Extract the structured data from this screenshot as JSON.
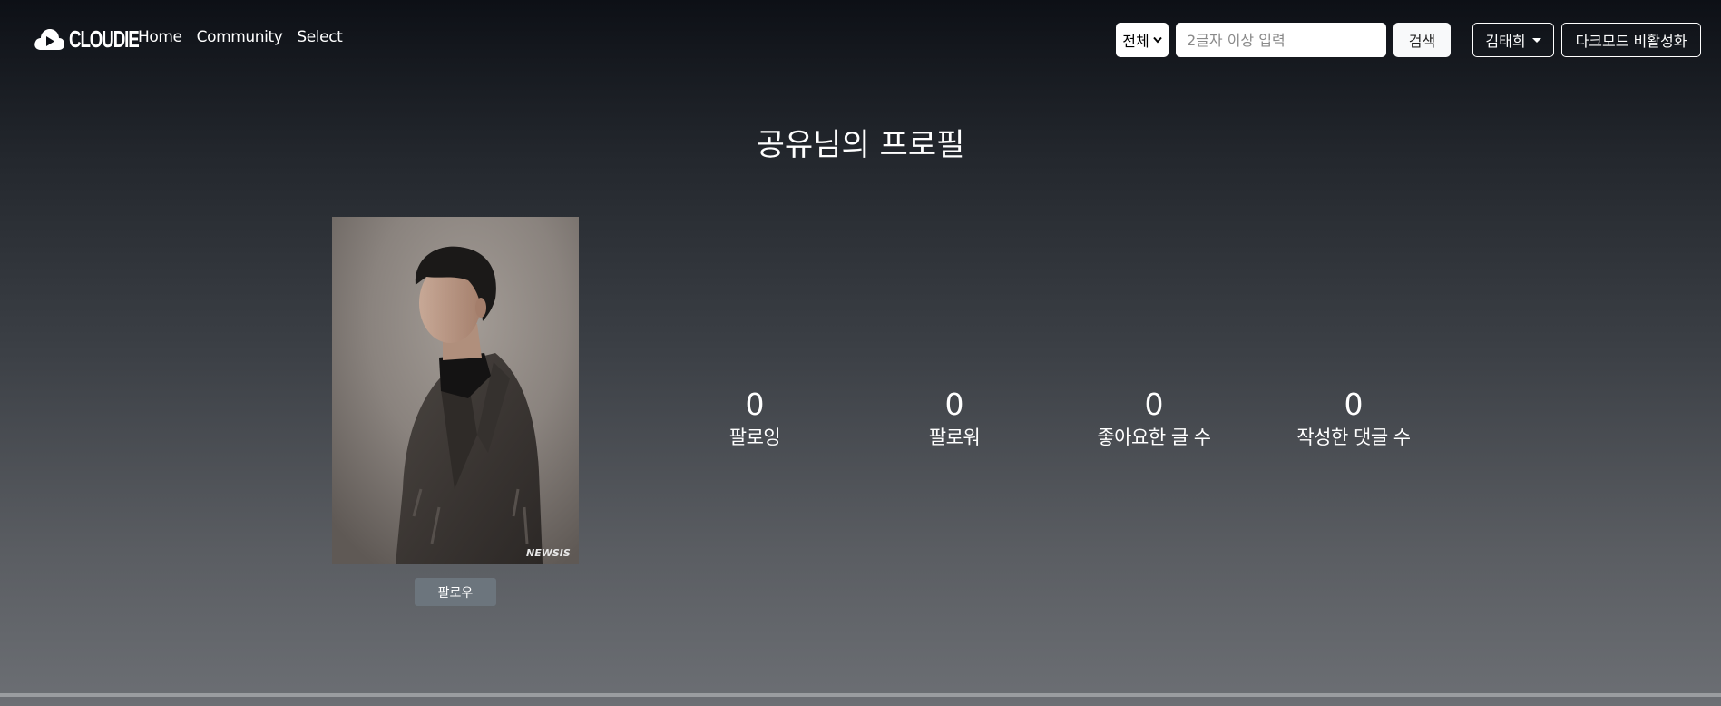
{
  "navbar": {
    "brand": "CLOUDIE",
    "links": [
      {
        "label": "Home"
      },
      {
        "label": "Community"
      },
      {
        "label": "Select"
      }
    ],
    "search": {
      "scope_selected": "전체",
      "placeholder": "2글자 이상 입력",
      "button_label": "검색"
    },
    "user_name": "김태희",
    "dark_mode_toggle": "다크모드 비활성화"
  },
  "profile": {
    "title": "공유님의 프로필",
    "photo_watermark": "NEWSIS",
    "follow_button": "팔로우",
    "stats": [
      {
        "value": "0",
        "label": "팔로잉"
      },
      {
        "value": "0",
        "label": "팔로워"
      },
      {
        "value": "0",
        "label": "좋아요한 글 수"
      },
      {
        "value": "0",
        "label": "작성한 댓글 수"
      }
    ]
  }
}
